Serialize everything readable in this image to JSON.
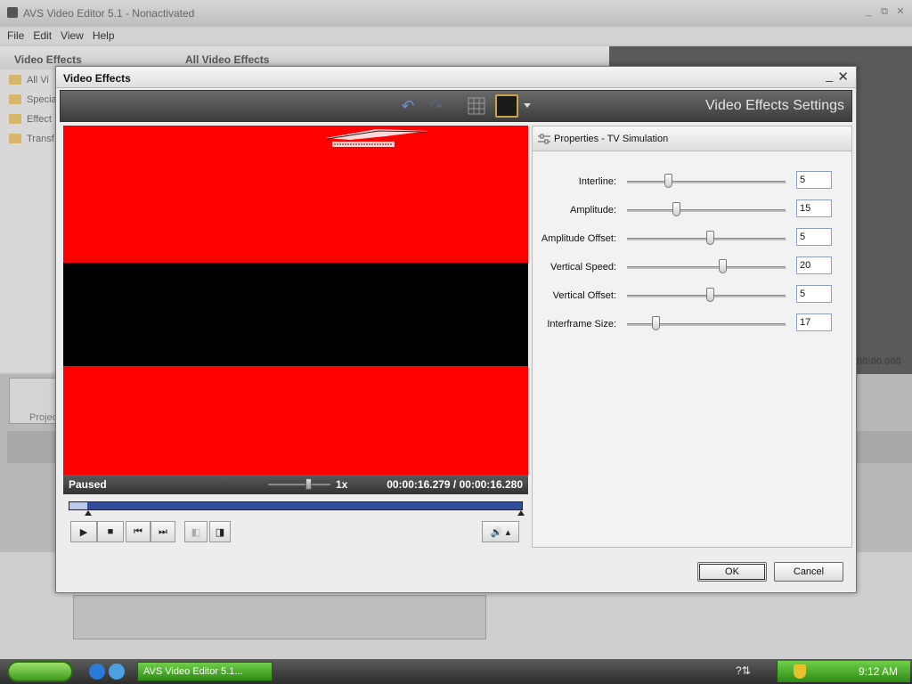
{
  "app": {
    "title": "AVS Video Editor 5.1 - Nonactivated",
    "menu": [
      "File",
      "Edit",
      "View",
      "Help"
    ],
    "left_header": "Video Effects",
    "center_header": "All Video Effects",
    "left_items": [
      "All Vi",
      "Specia",
      "Effect",
      "Transf"
    ],
    "time_readout": "00:00.000",
    "projector_label": "Projec"
  },
  "dialog": {
    "title": "Video Effects",
    "settings_title": "Video Effects Settings",
    "status": "Paused",
    "speed": "1x",
    "time": "00:00:16.279 / 00:00:16.280",
    "seek_progress": 0.04,
    "properties_title": "Properties - TV Simulation",
    "params": [
      {
        "label": "Interline:",
        "value": "5",
        "pos": 0.26
      },
      {
        "label": "Amplitude:",
        "value": "15",
        "pos": 0.31
      },
      {
        "label": "Amplitude Offset:",
        "value": "5",
        "pos": 0.52
      },
      {
        "label": "Vertical Speed:",
        "value": "20",
        "pos": 0.6
      },
      {
        "label": "Vertical Offset:",
        "value": "5",
        "pos": 0.52
      },
      {
        "label": "Interframe Size:",
        "value": "17",
        "pos": 0.18
      }
    ],
    "ok_label": "OK",
    "cancel_label": "Cancel"
  },
  "taskbar": {
    "task_label": "AVS Video Editor 5.1...",
    "clock": "9:12 AM"
  }
}
